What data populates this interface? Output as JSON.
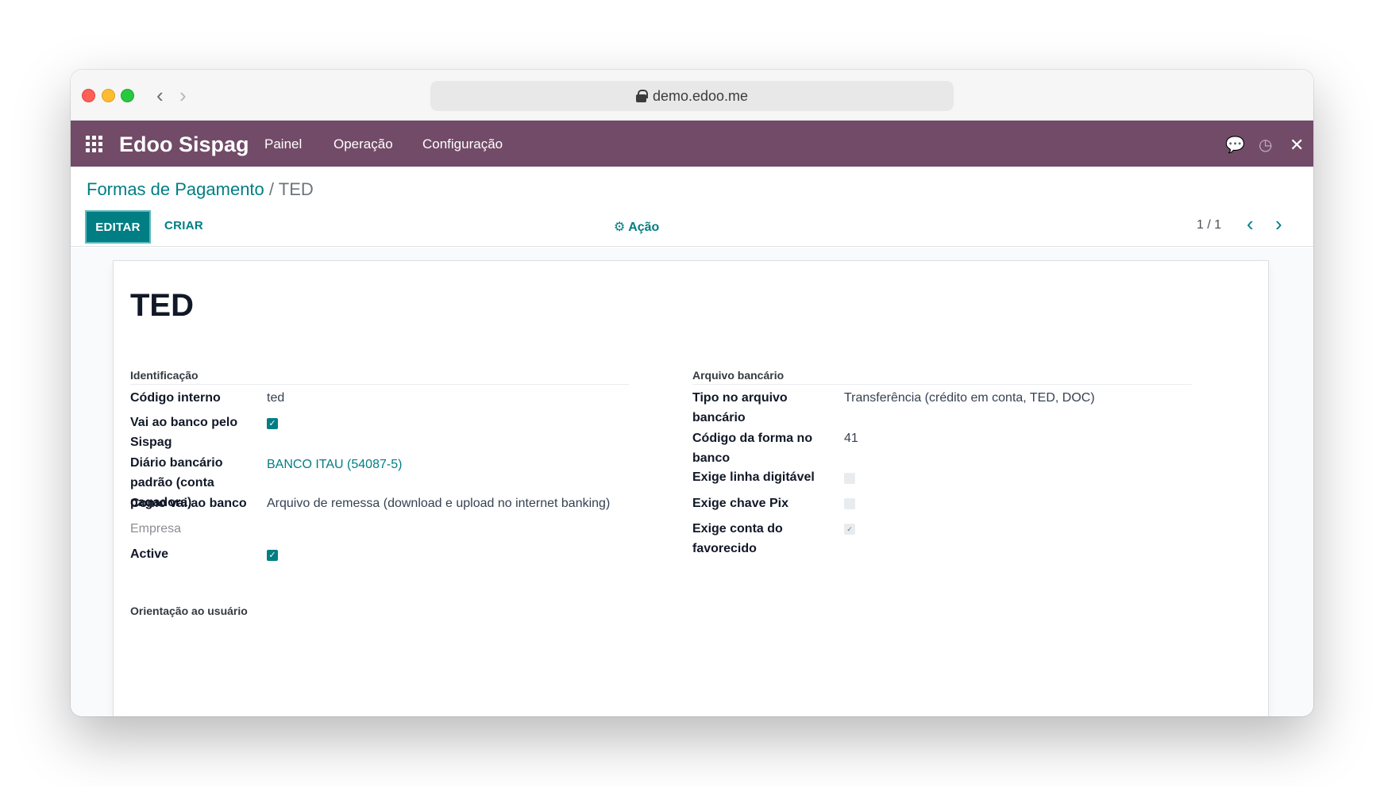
{
  "browser": {
    "url": "demo.edoo.me",
    "back_icon": "‹",
    "forward_icon": "›"
  },
  "navbar": {
    "brand": "Edoo Sispag",
    "menu": [
      "Painel",
      "Operação",
      "Configuração"
    ],
    "background": "#714b67"
  },
  "breadcrumb": {
    "parent": "Formas de Pagamento",
    "separator": "/",
    "current": "TED"
  },
  "toolbar": {
    "edit_label": "EDITAR",
    "create_label": "CRIAR",
    "action_label": "Ação",
    "pager": "1 / 1",
    "accent": "#017e84"
  },
  "record": {
    "title": "TED",
    "left_group": {
      "title": "Identificação",
      "fields": [
        {
          "label": "Código interno",
          "value": "ted"
        },
        {
          "label": "Vai ao banco pelo Sispag",
          "checked": true
        },
        {
          "label": "Diário bancário padrão (conta pagadora)",
          "value": "BANCO ITAU (54087-5)"
        },
        {
          "label": "Como vai ao banco",
          "value": "Arquivo de remessa (download e upload no internet banking)"
        },
        {
          "label": "Empresa",
          "value": ""
        },
        {
          "label": "Active",
          "checked": true
        }
      ]
    },
    "right_group": {
      "title": "Arquivo bancário",
      "fields": [
        {
          "label": "Tipo no arquivo bancário",
          "value": "Transferência (crédito em conta, TED, DOC)"
        },
        {
          "label": "Código da forma no banco",
          "value": "41"
        },
        {
          "label": "Exige linha digitável",
          "checked": false
        },
        {
          "label": "Exige chave Pix",
          "checked": false
        },
        {
          "label": "Exige conta do favorecido",
          "checked": true
        }
      ]
    },
    "notes_title": "Orientação ao usuário"
  }
}
